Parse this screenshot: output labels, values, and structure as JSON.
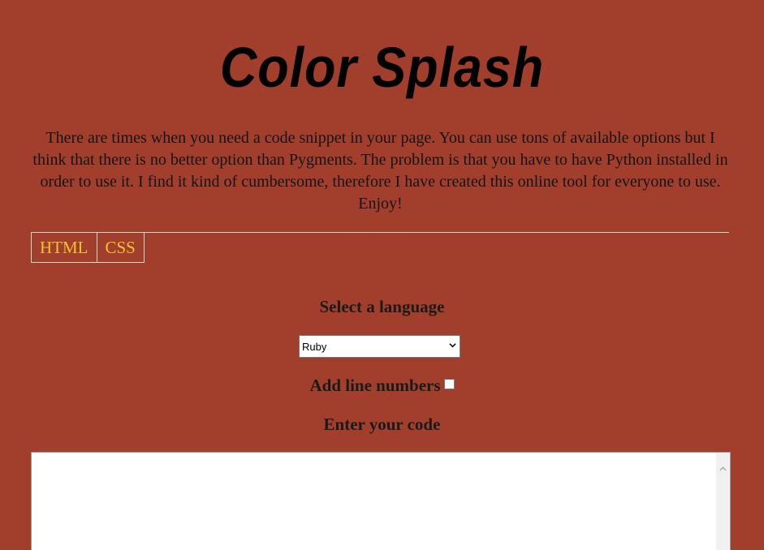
{
  "header": {
    "title": "Color Splash",
    "intro": "There are times when you need a code snippet in your page. You can use tons of available options but I think that there is no better option than Pygments. The problem is that you have to have Python installed in order to use it. I find it kind of cumbersome, therefore I have created this online tool for everyone to use. Enjoy!"
  },
  "tabs": [
    {
      "label": "HTML"
    },
    {
      "label": "CSS"
    }
  ],
  "form": {
    "language_label": "Select a language",
    "language_selected": "Ruby",
    "line_numbers_label": "Add line numbers",
    "line_numbers_checked": false,
    "code_label": "Enter your code",
    "code_value": ""
  },
  "colors": {
    "background": "#a23f2c",
    "tab_text": "#f1c232"
  },
  "icons": {
    "select_arrow": "chevron-down-icon",
    "scroll_up": "chevron-up-icon"
  }
}
